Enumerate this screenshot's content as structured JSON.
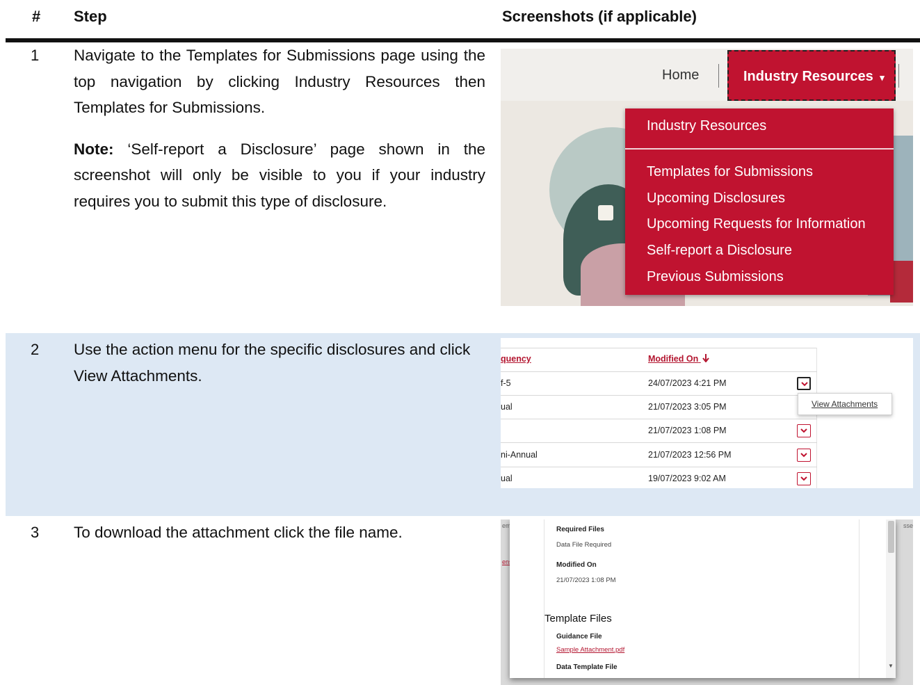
{
  "header": {
    "col_num": "#",
    "col_step": "Step",
    "col_screens": "Screenshots (if applicable)"
  },
  "steps": [
    {
      "number": "1",
      "text": "Navigate to the Templates for Submissions page using the top navigation by clicking Industry Resources then Templates for Submissions.",
      "note_label": "Note:",
      "note_text": " ‘Self-report a Disclosure’ page shown in the screenshot will only be visible to you if your industry requires you to submit this type of disclosure."
    },
    {
      "number": "2",
      "text": "Use the action menu for the specific disclosures and click View Attachments."
    },
    {
      "number": "3",
      "text": "To download the attachment click the file name."
    }
  ],
  "shot1": {
    "nav_home": "Home",
    "nav_industry": "Industry Resources",
    "nav_caret": "▾",
    "menu_header": "Industry Resources",
    "menu_items": [
      "Templates for Submissions",
      "Upcoming Disclosures",
      "Upcoming Requests for Information",
      "Self-report a Disclosure",
      "Previous Submissions"
    ],
    "colors": {
      "brand_red": "#c01330"
    }
  },
  "shot2": {
    "col_frequency": "quency",
    "col_modified": "Modified On",
    "sort_icon": "arrow-down-icon",
    "rows": [
      {
        "frequency": "f-5",
        "modified": "24/07/2023 4:21 PM"
      },
      {
        "frequency": "ual",
        "modified": "21/07/2023 3:05 PM"
      },
      {
        "frequency": "",
        "modified": "21/07/2023 1:08 PM"
      },
      {
        "frequency": "ni-Annual",
        "modified": "21/07/2023 12:56 PM"
      },
      {
        "frequency": "ual",
        "modified": "19/07/2023 9:02 AM"
      }
    ],
    "popup_item": "View Attachments"
  },
  "shot3": {
    "left_edge_1": "em",
    "left_edge_2": "ens",
    "right_edge": "sse",
    "required_files_label": "Required Files",
    "required_files_value": "Data File Required",
    "modified_label": "Modified On",
    "modified_value": "21/07/2023 1:08 PM",
    "section_title": "Template Files",
    "guidance_label": "Guidance File",
    "guidance_link": "Sample Attachment.pdf",
    "data_template_label": "Data Template File"
  }
}
